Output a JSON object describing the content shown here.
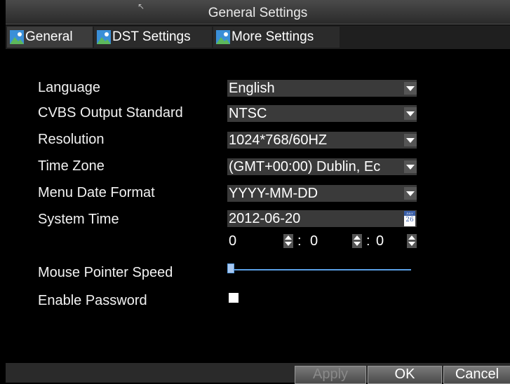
{
  "window": {
    "title": "General Settings"
  },
  "tabs": [
    {
      "label": "General",
      "icon": "landscape-icon",
      "active": true
    },
    {
      "label": "DST Settings",
      "icon": "landscape-icon",
      "active": false
    },
    {
      "label": "More Settings",
      "icon": "landscape-icon",
      "active": false
    }
  ],
  "fields": {
    "language": {
      "label": "Language",
      "value": "English"
    },
    "cvbs": {
      "label": "CVBS Output Standard",
      "value": "NTSC"
    },
    "resolution": {
      "label": "Resolution",
      "value": "1024*768/60HZ"
    },
    "timezone": {
      "label": "Time Zone",
      "value": "(GMT+00:00) Dublin, Ec"
    },
    "date_format": {
      "label": "Menu Date Format",
      "value": "YYYY-MM-DD"
    },
    "system_time": {
      "label": "System Time",
      "date": "2012-06-20",
      "calendar_month": "JULY",
      "calendar_day": "26",
      "hour": "0",
      "minute": "0",
      "second": "0",
      "separator": ":"
    },
    "mouse_speed": {
      "label": "Mouse Pointer Speed",
      "level_fraction": 0.0
    },
    "password": {
      "label": "Enable Password",
      "checked": false
    }
  },
  "buttons": {
    "apply": "Apply",
    "ok": "OK",
    "cancel": "Cancel"
  },
  "colors": {
    "accent": "#5aa0e6",
    "panel": "#3a3a3a"
  }
}
